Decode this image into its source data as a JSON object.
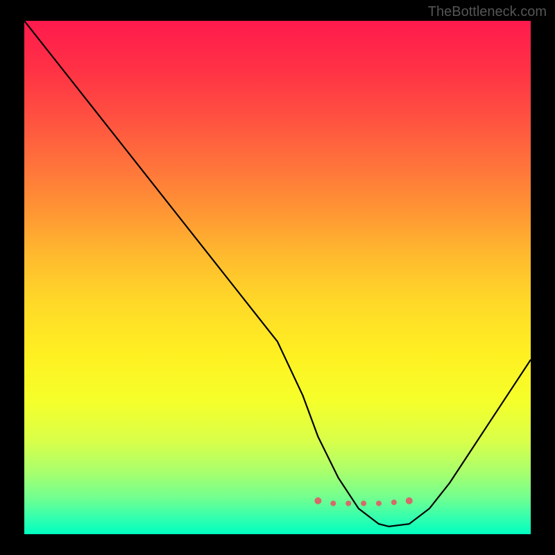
{
  "watermark": "TheBottleneck.com",
  "chart_data": {
    "type": "line",
    "title": "",
    "xlabel": "",
    "ylabel": "",
    "xlim": [
      0,
      100
    ],
    "ylim": [
      0,
      100
    ],
    "series": [
      {
        "name": "bottleneck-curve",
        "x": [
          0,
          10,
          20,
          30,
          40,
          50,
          55,
          58,
          62,
          66,
          70,
          72,
          76,
          80,
          84,
          88,
          92,
          96,
          100
        ],
        "values": [
          100,
          87.5,
          75,
          62.5,
          50,
          37.5,
          27,
          19,
          11,
          5,
          2,
          1.5,
          2,
          5,
          10,
          16,
          22,
          28,
          34
        ]
      }
    ],
    "valley_markers": {
      "x": [
        58,
        61,
        64,
        67,
        70,
        73,
        76
      ],
      "y": [
        6.5,
        6,
        6,
        6,
        6,
        6.2,
        6.5
      ],
      "color": "#d66a6a"
    },
    "gradient_stops": [
      {
        "pos": 0,
        "color": "#ff1a4d"
      },
      {
        "pos": 10,
        "color": "#ff3345"
      },
      {
        "pos": 20,
        "color": "#ff5540"
      },
      {
        "pos": 30,
        "color": "#ff7a3a"
      },
      {
        "pos": 38,
        "color": "#ff9933"
      },
      {
        "pos": 46,
        "color": "#ffbb2e"
      },
      {
        "pos": 55,
        "color": "#ffd928"
      },
      {
        "pos": 65,
        "color": "#fff022"
      },
      {
        "pos": 74,
        "color": "#f5ff2a"
      },
      {
        "pos": 82,
        "color": "#d8ff4a"
      },
      {
        "pos": 88,
        "color": "#a8ff6e"
      },
      {
        "pos": 93,
        "color": "#70ff90"
      },
      {
        "pos": 97,
        "color": "#30ffb0"
      },
      {
        "pos": 100,
        "color": "#00ffc0"
      }
    ]
  }
}
